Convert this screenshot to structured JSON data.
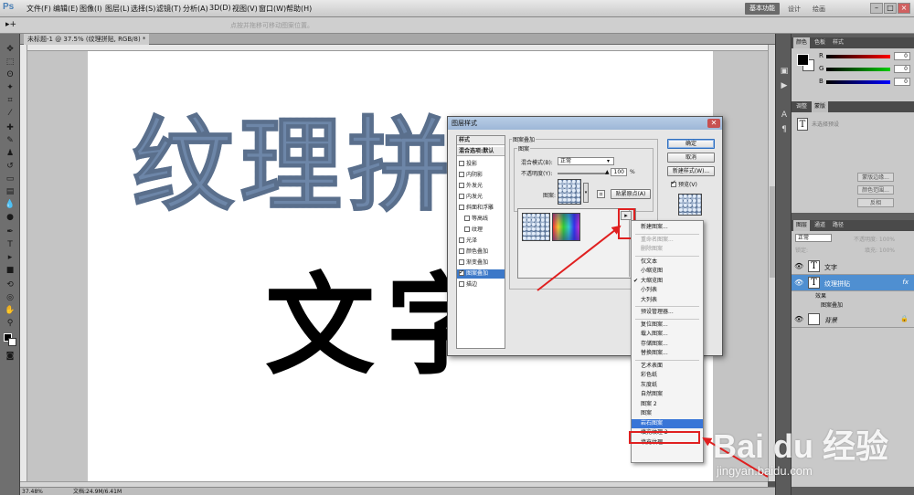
{
  "app": {
    "logo": "Ps"
  },
  "menu": [
    "文件(F)",
    "编辑(E)",
    "图像(I)",
    "图层(L)",
    "选择(S)",
    "滤镜(T)",
    "分析(A)",
    "3D(D)",
    "视图(V)",
    "窗口(W)",
    "帮助(H)"
  ],
  "workspace": {
    "active": "基本功能",
    "links": [
      "设计",
      "绘画"
    ]
  },
  "window_controls": [
    "–",
    "□",
    "×"
  ],
  "options_bar": {
    "hint": "点按并拖移可移动图案位置。"
  },
  "document": {
    "tab_title": "未标题-1 @ 37.5% (纹理拼贴, RGB/8) *",
    "text_textured": "纹理拼",
    "text_black": "文字",
    "zoom": "37.48%",
    "doc_size": "文档:24.9M/6.41M"
  },
  "color_panel": {
    "tabs": [
      "颜色",
      "色板",
      "样式"
    ],
    "rows": [
      {
        "label": "R",
        "value": "0",
        "color": "#ff0000"
      },
      {
        "label": "G",
        "value": "0",
        "color": "#00cc00"
      },
      {
        "label": "B",
        "value": "0",
        "color": "#0000ff"
      }
    ]
  },
  "char_panel": {
    "tabs": [
      "调整",
      "蒙版"
    ],
    "preset_label": "未选择预设",
    "buttons": [
      "蒙版边缘...",
      "颜色范围...",
      "反相"
    ]
  },
  "layers_panel": {
    "tabs": [
      "图层",
      "通道",
      "路径"
    ],
    "blend_mode": "正常",
    "opacity_label": "不透明度: 100%",
    "fill_label": "填充: 100%",
    "lock_label": "锁定:",
    "layers": [
      {
        "name": "文字",
        "thumb": "T",
        "fx": "",
        "active": false
      },
      {
        "name": "纹理拼贴",
        "thumb": "T",
        "fx": "fx",
        "active": true
      }
    ],
    "sub_effects": [
      "效果",
      "图案叠加"
    ],
    "background": "背景"
  },
  "dialog": {
    "title": "图层样式",
    "style_list": [
      {
        "label": "样式",
        "header": true,
        "checkbox": false,
        "checked": false,
        "selected": false
      },
      {
        "label": "混合选项:默认",
        "header": false,
        "checkbox": false,
        "checked": false,
        "selected": false
      },
      {
        "label": "投影",
        "header": false,
        "checkbox": true,
        "checked": false,
        "selected": false
      },
      {
        "label": "内阴影",
        "header": false,
        "checkbox": true,
        "checked": false,
        "selected": false
      },
      {
        "label": "外发光",
        "header": false,
        "checkbox": true,
        "checked": false,
        "selected": false
      },
      {
        "label": "内发光",
        "header": false,
        "checkbox": true,
        "checked": false,
        "selected": false
      },
      {
        "label": "斜面和浮雕",
        "header": false,
        "checkbox": true,
        "checked": false,
        "selected": false
      },
      {
        "label": "等高线",
        "header": false,
        "checkbox": true,
        "checked": false,
        "selected": false,
        "indent": true
      },
      {
        "label": "纹理",
        "header": false,
        "checkbox": true,
        "checked": false,
        "selected": false,
        "indent": true
      },
      {
        "label": "光泽",
        "header": false,
        "checkbox": true,
        "checked": false,
        "selected": false
      },
      {
        "label": "颜色叠加",
        "header": false,
        "checkbox": true,
        "checked": false,
        "selected": false
      },
      {
        "label": "渐变叠加",
        "header": false,
        "checkbox": true,
        "checked": false,
        "selected": false
      },
      {
        "label": "图案叠加",
        "header": false,
        "checkbox": true,
        "checked": true,
        "selected": true
      },
      {
        "label": "描边",
        "header": false,
        "checkbox": true,
        "checked": false,
        "selected": false
      }
    ],
    "section_title": "图案叠加",
    "group_title": "图案",
    "blend_label": "混合模式(B):",
    "blend_value": "正常",
    "opacity_label": "不透明度(Y):",
    "opacity_value": "100",
    "opacity_unit": "%",
    "pattern_label": "图案:",
    "snap_button": "贴紧原点(A)",
    "buttons": {
      "ok": "确定",
      "cancel": "取消",
      "new_style": "新建样式(W)...",
      "preview": "预览(V)"
    }
  },
  "context_menu": {
    "items": [
      {
        "label": "新建图案...",
        "state": "normal"
      },
      {
        "sep": true
      },
      {
        "label": "重命名图案...",
        "state": "disabled"
      },
      {
        "label": "删除图案",
        "state": "disabled"
      },
      {
        "sep": true
      },
      {
        "label": "仅文本",
        "state": "normal"
      },
      {
        "label": "小缩览图",
        "state": "normal"
      },
      {
        "label": "大缩览图",
        "state": "checked"
      },
      {
        "label": "小列表",
        "state": "normal"
      },
      {
        "label": "大列表",
        "state": "normal"
      },
      {
        "sep": true
      },
      {
        "label": "预设管理器...",
        "state": "normal"
      },
      {
        "sep": true
      },
      {
        "label": "复位图案...",
        "state": "normal"
      },
      {
        "label": "载入图案...",
        "state": "normal"
      },
      {
        "label": "存储图案...",
        "state": "normal"
      },
      {
        "label": "替换图案...",
        "state": "normal"
      },
      {
        "sep": true
      },
      {
        "label": "艺术表面",
        "state": "normal"
      },
      {
        "label": "彩色纸",
        "state": "normal"
      },
      {
        "label": "灰度纸",
        "state": "normal"
      },
      {
        "label": "自然图案",
        "state": "normal"
      },
      {
        "label": "图案 2",
        "state": "normal"
      },
      {
        "label": "图案",
        "state": "normal"
      },
      {
        "label": "岩石图案",
        "state": "highlight"
      },
      {
        "label": "填充纹理 2",
        "state": "normal"
      },
      {
        "label": "填充纹理",
        "state": "normal"
      }
    ]
  },
  "watermark": {
    "logo": "Bai du 经验",
    "url": "jingyan.baidu.com"
  },
  "colors": {
    "highlight": "#3875d7",
    "annotation": "#e02020",
    "layer_selected": "#4f8fd1"
  }
}
